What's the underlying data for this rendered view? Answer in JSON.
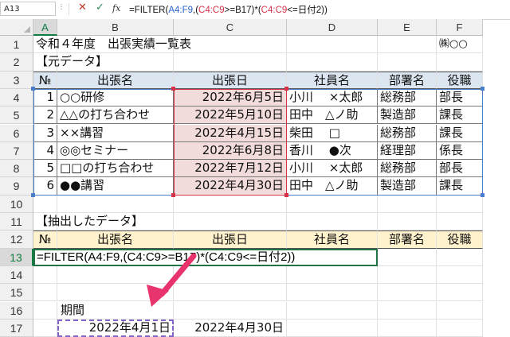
{
  "formula_bar": {
    "name_box": "A13",
    "cancel_icon": "✕",
    "enter_icon": "✓",
    "fx_label": "fx",
    "formula_parts": [
      "=FILTER(",
      "A4:F9",
      ",(",
      "C4:C9",
      ">=B17)*(",
      "C4:C9",
      "<=日付2))"
    ]
  },
  "columns": [
    "A",
    "B",
    "C",
    "D",
    "E",
    "F"
  ],
  "rows": [
    "1",
    "2",
    "3",
    "4",
    "5",
    "6",
    "7",
    "8",
    "9",
    "10",
    "11",
    "12",
    "13",
    "14",
    "15",
    "16",
    "17"
  ],
  "sheet": {
    "title": "令和４年度　出張実績一覧表",
    "company": "㈱○○",
    "section_original": "【元データ】",
    "section_extract": "【抽出したデータ】",
    "headers": [
      "№",
      "出張名",
      "出張日",
      "社員名",
      "部署名",
      "役職"
    ],
    "records": [
      [
        "1",
        "○○研修",
        "2022年6月5日",
        "小川　 ×太郎",
        "総務部",
        "部長"
      ],
      [
        "2",
        "△△の打ち合わせ",
        "2022年5月10日",
        "田中　△ノ助",
        "製造部",
        "課長"
      ],
      [
        "3",
        "××講習",
        "2022年4月15日",
        "柴田　 □",
        "総務部",
        "課長"
      ],
      [
        "4",
        "◎◎セミナー",
        "2022年6月8日",
        "香川　 ●次",
        "経理部",
        "係長"
      ],
      [
        "5",
        "□□の打ち合わせ",
        "2022年7月12日",
        "小川　 ×太郎",
        "総務部",
        "部長"
      ],
      [
        "6",
        "●●講習",
        "2022年4月30日",
        "田中　△ノ助",
        "製造部",
        "課長"
      ]
    ],
    "editing_formula": "=FILTER(A4:F9,(C4:C9>=B17)*(C4:C9<=日付2))",
    "period_label": "期間",
    "date_from": "2022年4月1日",
    "date_to": "2022年4月30日"
  },
  "colors": {
    "header_blue": "#dce6f1",
    "header_yellow": "#fff2cc",
    "date_pink": "#f2dcdb",
    "excel_green": "#217346",
    "arrow": "#e8336d"
  }
}
